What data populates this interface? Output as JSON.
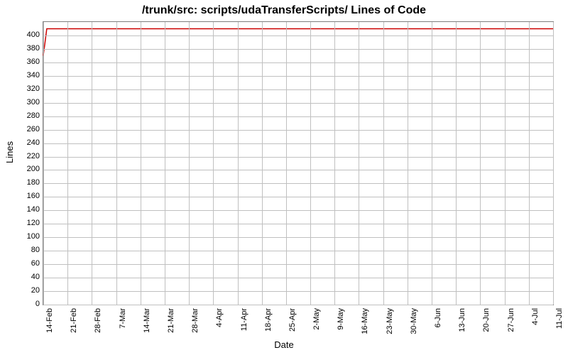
{
  "chart_data": {
    "type": "line",
    "title": "/trunk/src: scripts/udaTransferScripts/ Lines of Code",
    "xlabel": "Date",
    "ylabel": "Lines",
    "ylim": [
      0,
      420
    ],
    "xlim_days": [
      0,
      147
    ],
    "y_ticks": [
      0,
      20,
      40,
      60,
      80,
      100,
      120,
      140,
      160,
      180,
      200,
      220,
      240,
      260,
      280,
      300,
      320,
      340,
      360,
      380,
      400
    ],
    "x_ticks": [
      {
        "day": 0,
        "label": "14-Feb"
      },
      {
        "day": 7,
        "label": "21-Feb"
      },
      {
        "day": 14,
        "label": "28-Feb"
      },
      {
        "day": 21,
        "label": "7-Mar"
      },
      {
        "day": 28,
        "label": "14-Mar"
      },
      {
        "day": 35,
        "label": "21-Mar"
      },
      {
        "day": 42,
        "label": "28-Mar"
      },
      {
        "day": 49,
        "label": "4-Apr"
      },
      {
        "day": 56,
        "label": "11-Apr"
      },
      {
        "day": 63,
        "label": "18-Apr"
      },
      {
        "day": 70,
        "label": "25-Apr"
      },
      {
        "day": 77,
        "label": "2-May"
      },
      {
        "day": 84,
        "label": "9-May"
      },
      {
        "day": 91,
        "label": "16-May"
      },
      {
        "day": 98,
        "label": "23-May"
      },
      {
        "day": 105,
        "label": "30-May"
      },
      {
        "day": 112,
        "label": "6-Jun"
      },
      {
        "day": 119,
        "label": "13-Jun"
      },
      {
        "day": 126,
        "label": "20-Jun"
      },
      {
        "day": 133,
        "label": "27-Jun"
      },
      {
        "day": 140,
        "label": "4-Jul"
      },
      {
        "day": 147,
        "label": "11-Jul"
      }
    ],
    "series": [
      {
        "name": "Lines of Code",
        "color": "#cc0000",
        "points": [
          {
            "day": 0,
            "value": 370
          },
          {
            "day": 1,
            "value": 410
          },
          {
            "day": 147,
            "value": 410
          }
        ]
      }
    ]
  }
}
